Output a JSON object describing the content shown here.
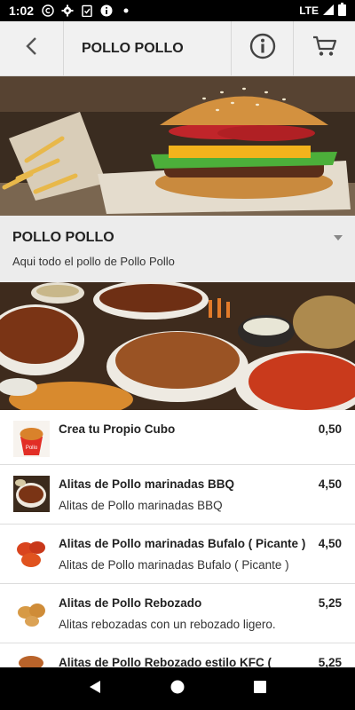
{
  "status_bar": {
    "time": "1:02",
    "network": "LTE",
    "icons": [
      "copyright-icon",
      "gear-icon",
      "clipboard-check-icon",
      "info-icon",
      "dot-icon"
    ]
  },
  "app_bar": {
    "title": "POLLO POLLO",
    "back_icon": "back-arrow-icon",
    "info_icon": "info-icon",
    "cart_icon": "cart-icon"
  },
  "category": {
    "title": "POLLO POLLO",
    "description": "Aqui todo el pollo de Pollo Pollo"
  },
  "items": [
    {
      "name": "Crea tu Propio Cubo",
      "description": "",
      "price": "0,50"
    },
    {
      "name": "Alitas de Pollo marinadas BBQ",
      "description": "Alitas de Pollo marinadas BBQ",
      "price": "4,50"
    },
    {
      "name": "Alitas de Pollo marinadas Bufalo ( Picante )",
      "description": "Alitas de Pollo marinadas Bufalo ( Picante )",
      "price": "4,50"
    },
    {
      "name": "Alitas de Pollo Rebozado",
      "description": "Alitas rebozadas con un rebozado ligero.",
      "price": "5,25"
    },
    {
      "name": "Alitas de Pollo Rebozado estilo KFC (",
      "description": "",
      "price": "5,25"
    }
  ],
  "colors": {
    "app_bar_bg": "#f1f1f1",
    "category_bg": "#ececec",
    "status_bar_bg": "#000000"
  }
}
